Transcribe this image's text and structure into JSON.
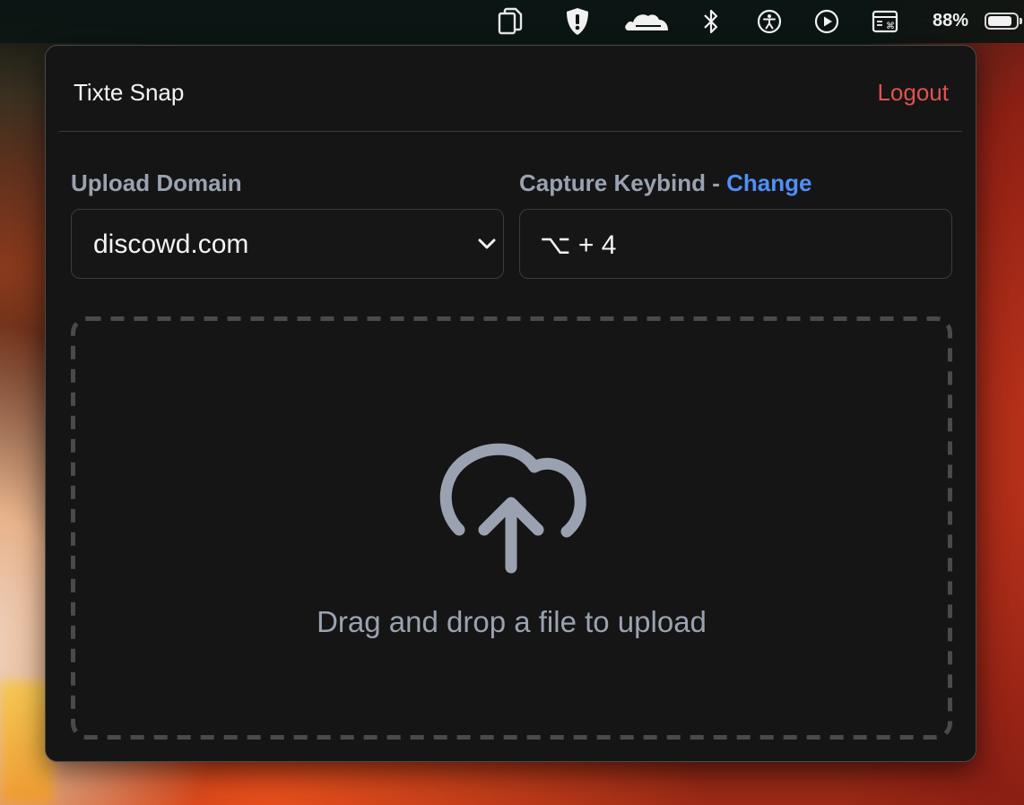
{
  "menubar": {
    "icons": [
      "clipboard-icon",
      "shield-icon",
      "cloudflare-icon",
      "bluetooth-icon",
      "accessibility-icon",
      "play-icon",
      "keyboard-viewer-icon"
    ],
    "battery_percent": "88%",
    "battery_level": 0.88
  },
  "app": {
    "title": "Tixte Snap",
    "logout_label": "Logout"
  },
  "upload_domain": {
    "label": "Upload Domain",
    "value": "discowd.com"
  },
  "keybind": {
    "label": "Capture Keybind - ",
    "change_label": "Change",
    "value": "⌥ + 4"
  },
  "dropzone": {
    "text": "Drag and drop a file to upload",
    "icon": "cloud-upload-icon"
  },
  "colors": {
    "logout": "#e0534b",
    "link": "#4f8ff7",
    "muted": "#9aa2b1",
    "panel_bg": "#151515"
  }
}
